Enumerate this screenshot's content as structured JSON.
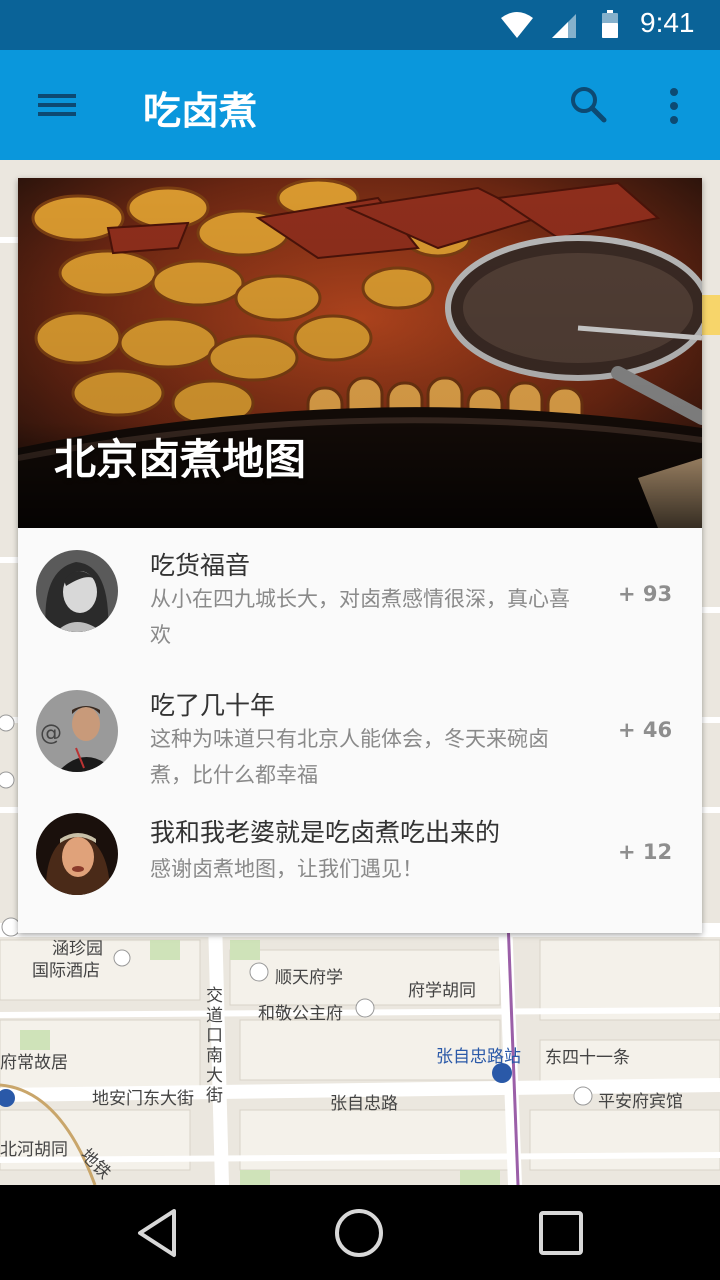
{
  "status_bar": {
    "time": "9:41",
    "icons": [
      "wifi-icon",
      "signal-icon",
      "battery-icon"
    ]
  },
  "app_bar": {
    "title": "吃卤煮",
    "icons": [
      "menu-icon",
      "search-icon",
      "more-vert-icon"
    ]
  },
  "colors": {
    "status_bar": "#0a6398",
    "app_bar": "#0a97dc",
    "card": "#fafafa",
    "map": "#ebe7df"
  },
  "map": {
    "labels": [
      "涵珍园",
      "国际酒店",
      "顺天府学",
      "府学胡同",
      "和敬公主府",
      "交道口南大街",
      "张自忠路站",
      "东四十一条",
      "府常故居",
      "地安门东大街",
      "张自忠路",
      "平安府宾馆",
      "北河胡同",
      "地铁"
    ]
  },
  "card": {
    "hero_title": "北京卤煮地图",
    "items": [
      {
        "title": "吃货福音",
        "desc": "从小在四九城长大，对卤煮感情很深，真心喜欢",
        "count": "+ 93"
      },
      {
        "title": "吃了几十年",
        "desc": "这种为味道只有北京人能体会，冬天来碗卤煮，比什么都幸福",
        "count": "+ 46"
      },
      {
        "title": "我和我老婆就是吃卤煮吃出来的",
        "desc": "感谢卤煮地图，让我们遇见！",
        "count": "+ 12"
      }
    ]
  },
  "nav_bar": {
    "icons": [
      "back-icon",
      "home-icon",
      "recents-icon"
    ]
  }
}
